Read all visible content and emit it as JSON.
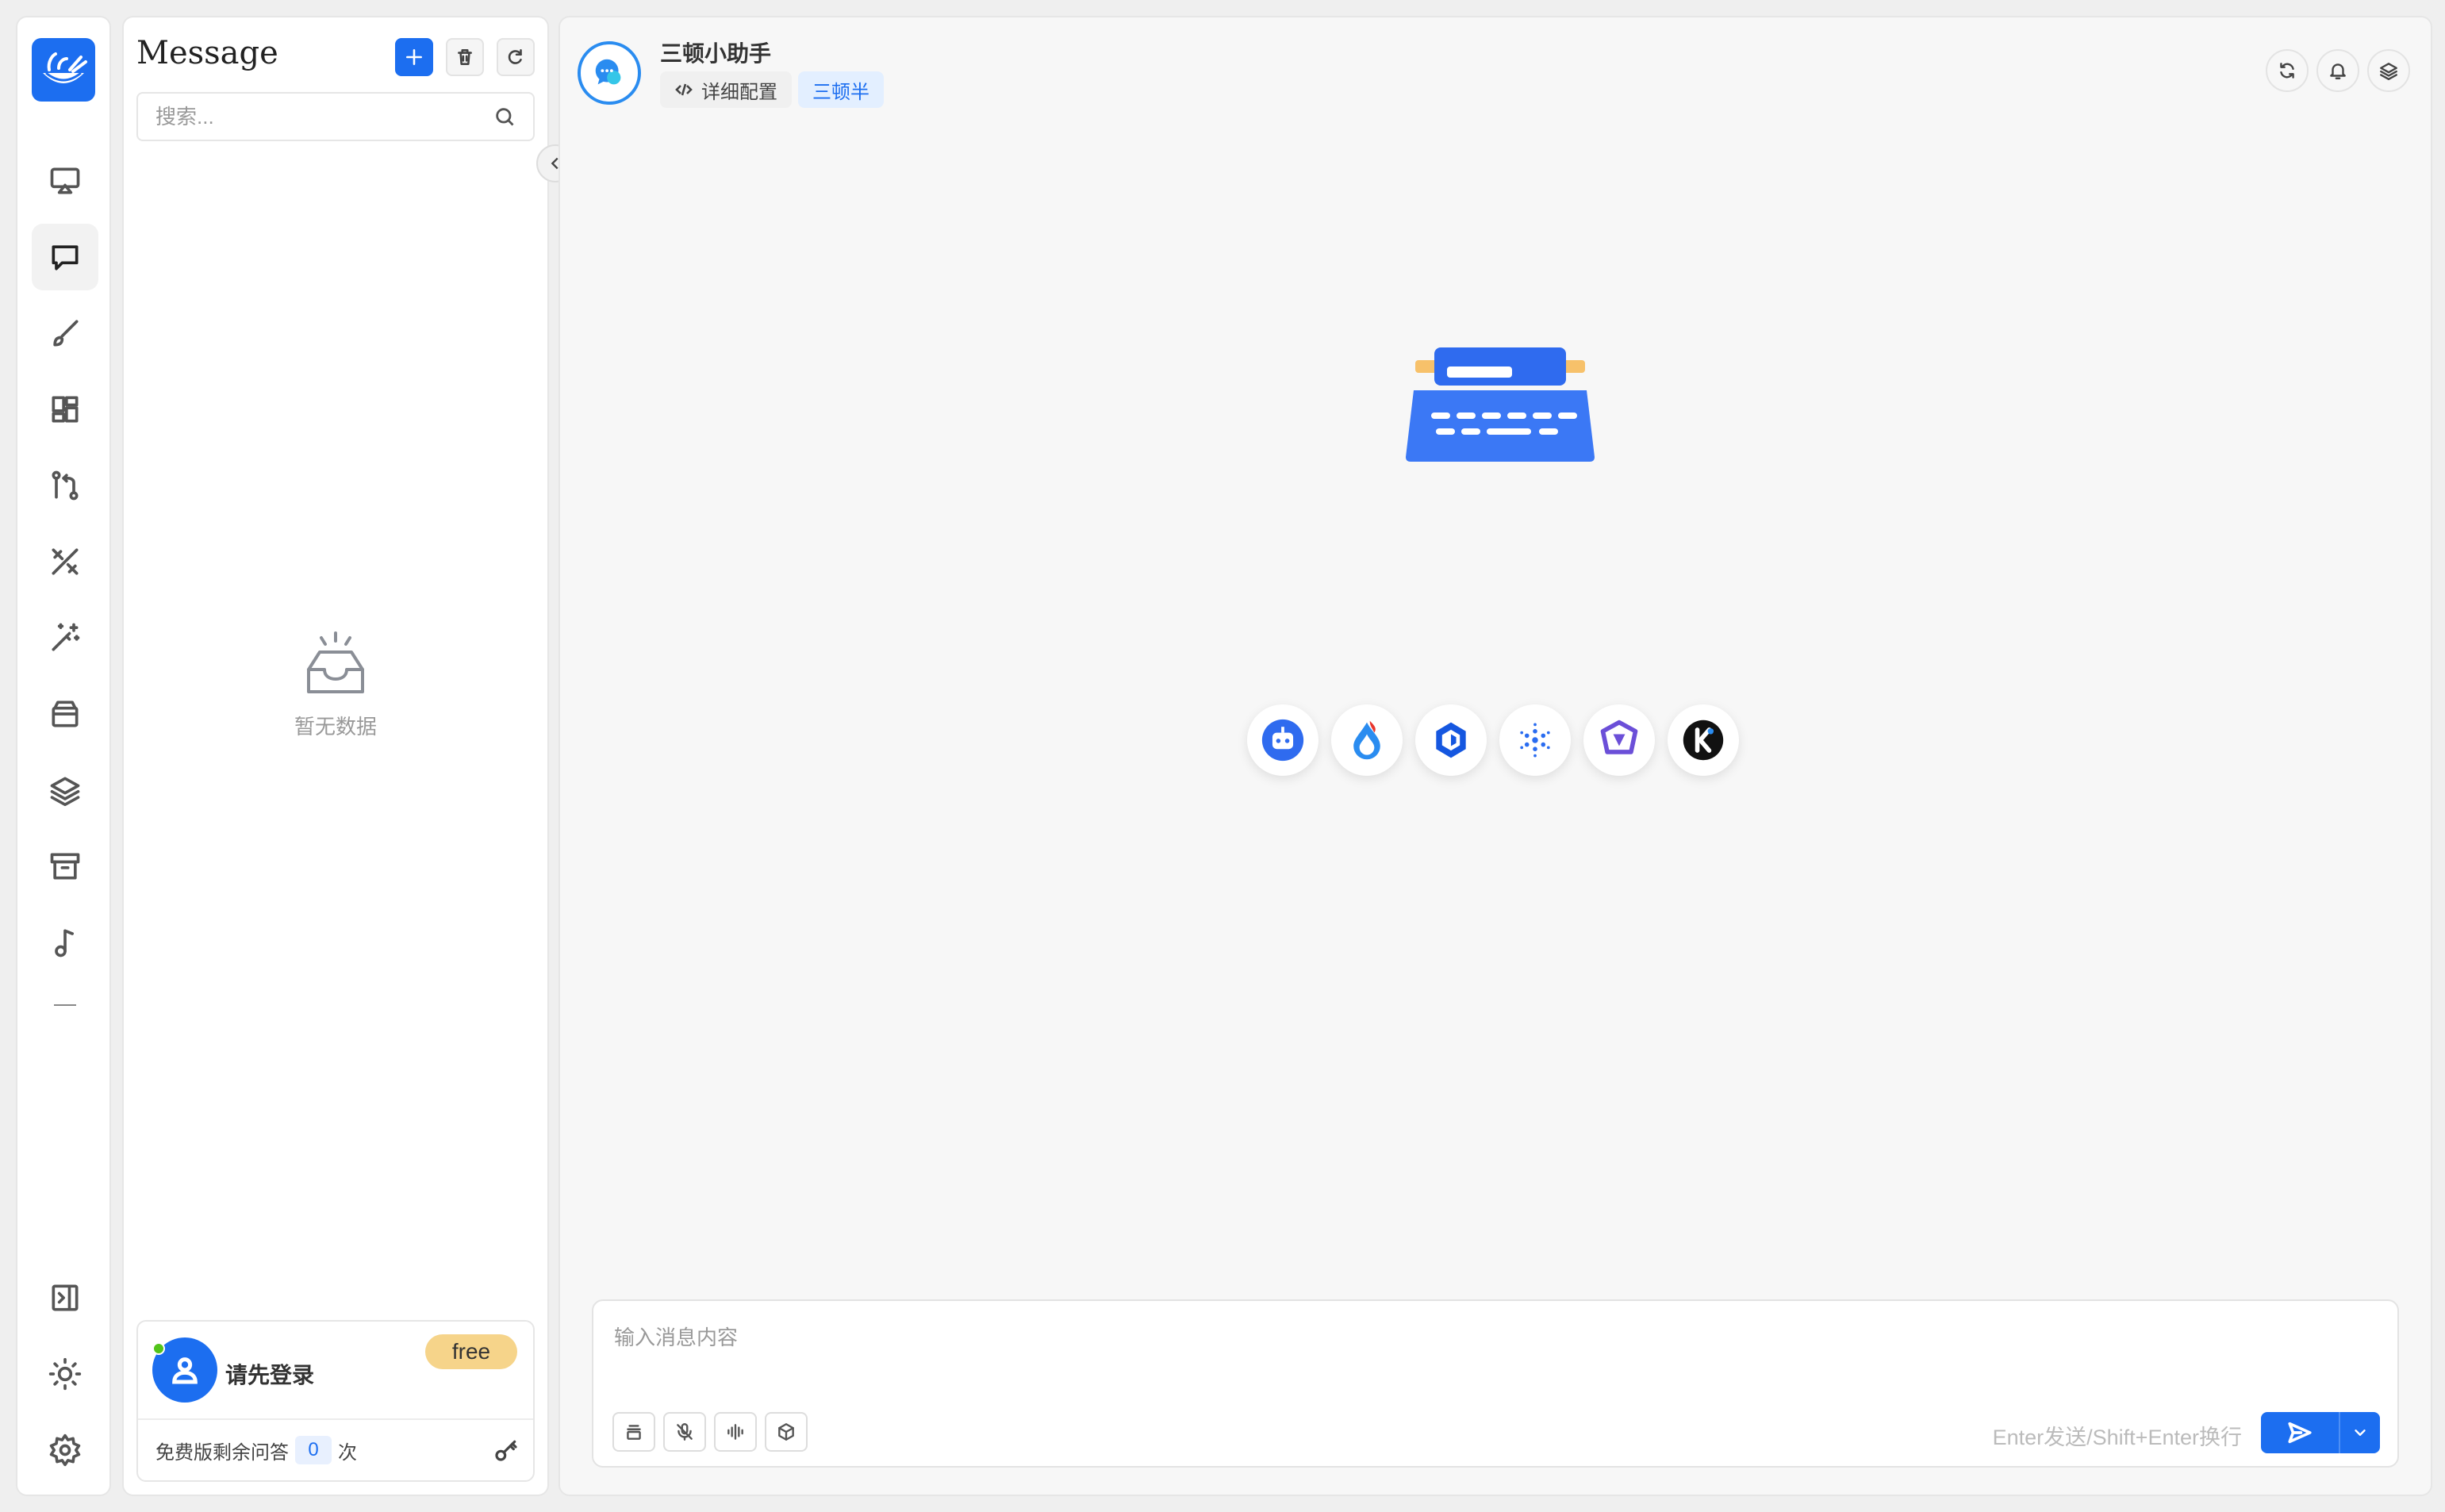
{
  "conversation_panel": {
    "title": "Message",
    "search_placeholder": "搜索...",
    "empty_text": "暂无数据",
    "user": {
      "login_prompt": "请先登录",
      "plan_badge": "free",
      "quota_label": "免费版剩余问答",
      "quota_count": "0",
      "quota_unit": "次"
    }
  },
  "sidebar": {
    "items": [
      {
        "icon": "monitor-icon",
        "active": false
      },
      {
        "icon": "chat-icon",
        "active": true
      },
      {
        "icon": "brush-icon",
        "active": false
      },
      {
        "icon": "apps-grid-icon",
        "active": false
      },
      {
        "icon": "git-compare-icon",
        "active": false
      },
      {
        "icon": "design-tools-icon",
        "active": false
      },
      {
        "icon": "magic-wand-icon",
        "active": false
      },
      {
        "icon": "package-icon",
        "active": false
      },
      {
        "icon": "layers-icon",
        "active": false
      },
      {
        "icon": "archive-icon",
        "active": false
      },
      {
        "icon": "music-note-icon",
        "active": false
      }
    ],
    "bottom": [
      {
        "icon": "expand-panel-icon"
      },
      {
        "icon": "sun-icon"
      },
      {
        "icon": "settings-icon"
      }
    ]
  },
  "chat": {
    "bot_name": "三顿小助手",
    "config_tag": "详细配置",
    "user_tag": "三顿半",
    "input_placeholder": "输入消息内容",
    "send_hint": "Enter发送/Shift+Enter换行",
    "models": [
      "chatbot-icon",
      "ernie-icon",
      "zhipu-icon",
      "spark-icon",
      "qwen-icon",
      "kimi-icon"
    ]
  },
  "colors": {
    "accent": "#1c6ef0",
    "plan_badge": "#f6d48a",
    "background": "#f7f7f7"
  }
}
